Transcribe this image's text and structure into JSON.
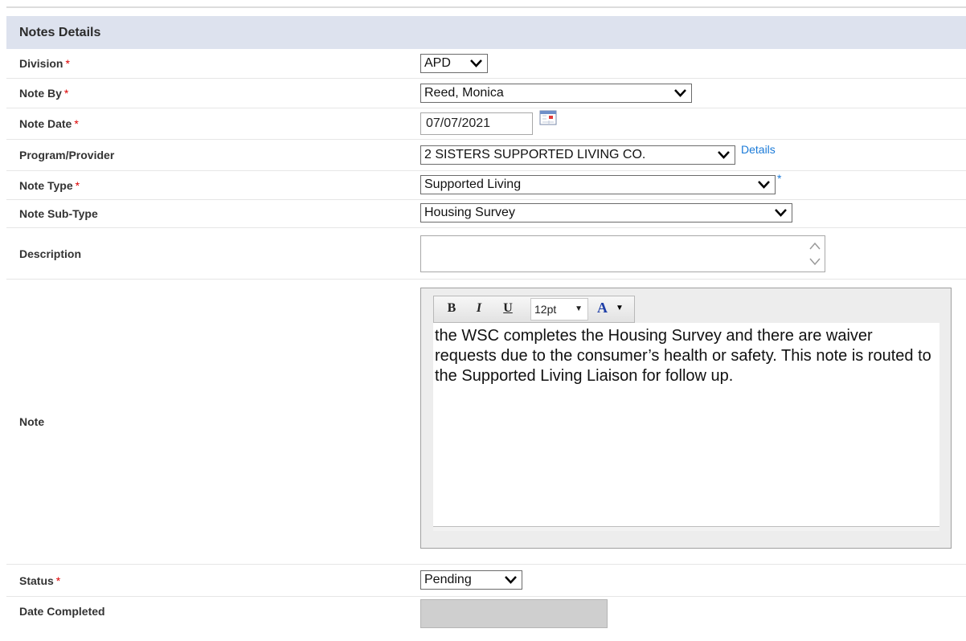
{
  "panel": {
    "title": "Notes Details"
  },
  "fields": {
    "division": {
      "label": "Division",
      "required": "*",
      "value": "APD"
    },
    "note_by": {
      "label": "Note By",
      "required": "*",
      "value": "Reed, Monica"
    },
    "note_date": {
      "label": "Note Date",
      "required": "*",
      "value": "07/07/2021"
    },
    "program": {
      "label": "Program/Provider",
      "value": "2 SISTERS SUPPORTED LIVING CO.",
      "link": "Details"
    },
    "note_type": {
      "label": "Note Type",
      "required": "*",
      "value": "Supported Living",
      "after_mark": "*"
    },
    "sub_type": {
      "label": "Note Sub-Type",
      "value": "Housing Survey"
    },
    "description": {
      "label": "Description",
      "value": ""
    },
    "note": {
      "label": "Note",
      "toolbar": {
        "bold": "B",
        "italic": "I",
        "underline": "U",
        "font_size": "12pt",
        "font_color": "A"
      },
      "text": "the WSC completes the Housing Survey and there are waiver requests due to the consumer’s health or safety. This note is routed to the Supported Living Liaison for follow up."
    },
    "status": {
      "label": "Status",
      "required": "*",
      "value": "Pending"
    },
    "date_completed": {
      "label": "Date Completed",
      "value": ""
    }
  },
  "colors": {
    "header_bg": "#dde2ee",
    "required": "#dd0000",
    "link": "#1a7ad8"
  }
}
